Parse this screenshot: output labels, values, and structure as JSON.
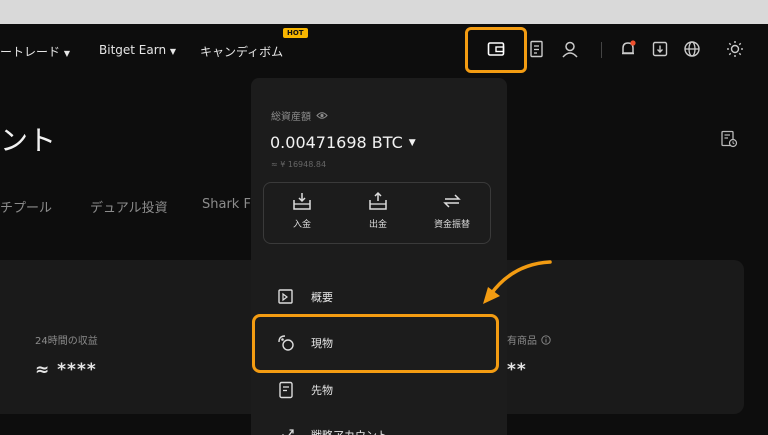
{
  "nav": {
    "item1": "ートレード",
    "item2": "Bitget Earn",
    "item3": "キャンディボム",
    "hot_badge": "HOT"
  },
  "page": {
    "title": "ント",
    "tabs": [
      "チプール",
      "デュアル投資",
      "Shark F"
    ]
  },
  "card": {
    "label_24h": "24時間の収益",
    "value_24h": "≈ ****",
    "label_right": "有商品",
    "value_right": "**"
  },
  "wallet_panel": {
    "total_label": "総資産額",
    "balance": "0.00471698 BTC",
    "fiat": "≈ ¥ 16948.84",
    "actions": [
      {
        "label": "入金"
      },
      {
        "label": "出金"
      },
      {
        "label": "資金振替"
      }
    ],
    "menu": [
      {
        "label": "概要"
      },
      {
        "label": "現物"
      },
      {
        "label": "先物"
      },
      {
        "label": "戦略アカウント"
      }
    ]
  },
  "colors": {
    "accent": "#f39c12",
    "background": "#0d0d0d",
    "panel": "#1c1c1c",
    "notification_dot": "#f0502d"
  },
  "icons": [
    "wallet-icon",
    "orders-icon",
    "user-icon",
    "bell-icon",
    "download-icon",
    "globe-icon",
    "sun-icon",
    "history-icon",
    "eye-icon",
    "caret-down-icon",
    "deposit-icon",
    "withdraw-icon",
    "transfer-icon",
    "overview-icon",
    "spot-icon",
    "futures-icon",
    "strategy-icon",
    "info-icon"
  ]
}
